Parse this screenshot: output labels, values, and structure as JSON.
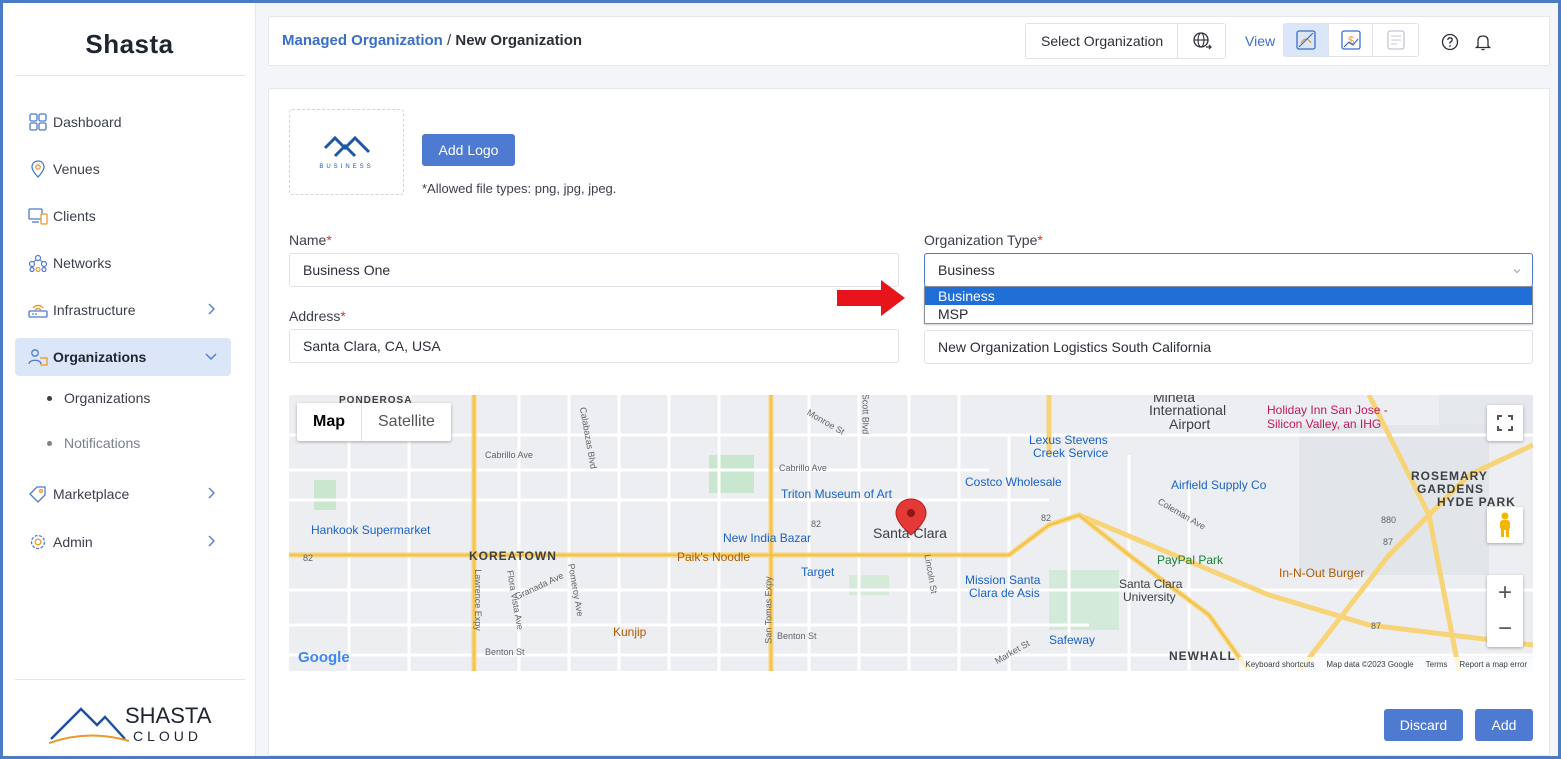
{
  "sidebar": {
    "brand": "Shasta",
    "items": [
      {
        "label": "Dashboard"
      },
      {
        "label": "Venues"
      },
      {
        "label": "Clients"
      },
      {
        "label": "Networks"
      },
      {
        "label": "Infrastructure"
      },
      {
        "label": "Organizations"
      },
      {
        "label": "Marketplace"
      },
      {
        "label": "Admin"
      }
    ],
    "sub_items": [
      {
        "label": "Organizations"
      },
      {
        "label": "Notifications"
      }
    ],
    "footer_logo": {
      "line1": "SHASTA",
      "line2": "CLOUD"
    }
  },
  "header": {
    "breadcrumb_parent": "Managed Organization",
    "breadcrumb_separator": "/",
    "breadcrumb_current": "New Organization",
    "org_select_label": "Select Organization",
    "view_label": "View"
  },
  "form": {
    "logo_text": "BUSINESS",
    "add_logo_label": "Add Logo",
    "file_hint": "*Allowed file types: png, jpg, jpeg.",
    "name_label": "Name",
    "name_value": "Business One",
    "org_type_label": "Organization Type",
    "org_type_value": "Business",
    "org_type_options": [
      "Business",
      "MSP"
    ],
    "address_label": "Address",
    "address_value": "Santa Clara, CA, USA",
    "description_value": "New Organization Logistics South California",
    "required_marker": "*"
  },
  "map": {
    "type_map": "Map",
    "type_satellite": "Satellite",
    "labels": {
      "mineta": "Mineta",
      "international": "International",
      "airport": "Airport",
      "holiday_inn": "Holiday Inn San Jose -",
      "silicon_valley": "Silicon Valley, an IHG",
      "lexus": "Lexus Stevens",
      "creek_service": "Creek Service",
      "costco": "Costco Wholesale",
      "airfield": "Airfield Supply Co",
      "rosemary": "ROSEMARY",
      "gardens": "GARDENS",
      "hyde_park": "HYDE PARK",
      "triton": "Triton Museum of Art",
      "santa_clara": "Santa Clara",
      "hankook": "Hankook Supermarket",
      "new_india": "New India Bazar",
      "koreatown": "KOREATOWN",
      "paiks": "Paik's Noodle",
      "target": "Target",
      "paypal": "PayPal Park",
      "in_n_out": "In-N-Out Burger",
      "mission_santa": "Mission Santa",
      "clara_de_asis": "Clara de Asis",
      "scu_1": "Santa Clara",
      "scu_2": "University",
      "kunjip": "Kunjip",
      "safeway": "Safeway",
      "newhall": "NEWHALL",
      "ponderosa": "PONDEROSA",
      "cabrillo_1": "Cabrillo Ave",
      "cabrillo_2": "Cabrillo Ave",
      "monroe": "Monroe St",
      "scott": "Scott Blvd",
      "calabazas": "Calabazas Blvd",
      "lawrence": "Lawrence Expy",
      "san_tomas": "San Tomas Expy",
      "lincoln": "Lincoln St",
      "coleman": "Coleman Ave",
      "benton": "Benton St",
      "market": "Market St",
      "granada": "Granada Ave",
      "flora_vista": "Flora Vista Ave",
      "pomeroy": "Pomeroy Ave",
      "benton2": "Benton St",
      "route_82a": "82",
      "route_82b": "82",
      "route_82c": "82",
      "route_87a": "87",
      "route_87b": "87",
      "route_880": "880"
    },
    "footer": {
      "shortcuts": "Keyboard shortcuts",
      "mapdata": "Map data ©2023 Google",
      "terms": "Terms",
      "report": "Report a map error"
    },
    "google": "Google"
  },
  "actions": {
    "discard_label": "Discard",
    "add_label": "Add"
  },
  "colors": {
    "accent": "#4f7ad1",
    "link": "#3a6fc5",
    "required": "#d9342b",
    "dropdown_selected": "#1f6fd6",
    "arrow": "#e8141b"
  }
}
